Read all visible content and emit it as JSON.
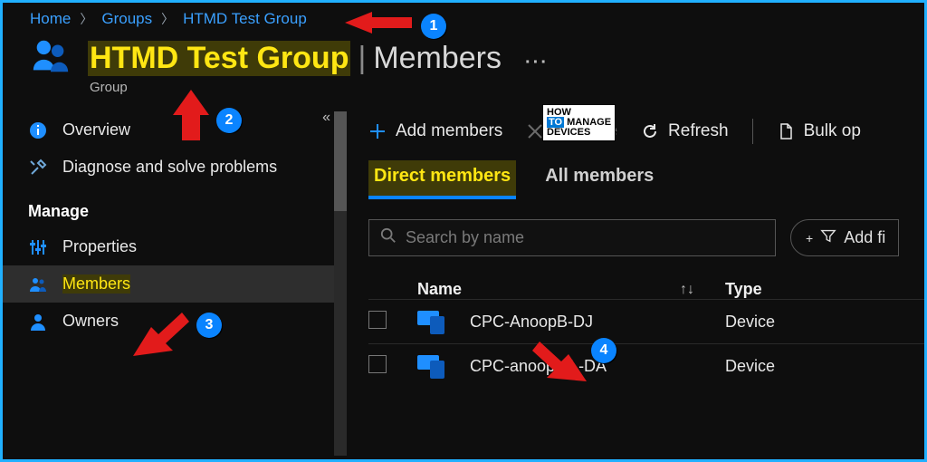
{
  "breadcrumb": {
    "home": "Home",
    "groups": "Groups",
    "group_name": "HTMD Test Group"
  },
  "header": {
    "title_highlight": "HTMD Test Group",
    "title_subpage": "Members",
    "subtitle": "Group",
    "more": "···"
  },
  "sidebar": {
    "items": [
      {
        "icon": "info",
        "label": "Overview"
      },
      {
        "icon": "wrench",
        "label": "Diagnose and solve problems"
      }
    ],
    "manage_label": "Manage",
    "manage_items": [
      {
        "icon": "sliders",
        "label": "Properties"
      },
      {
        "icon": "people",
        "label": "Members"
      },
      {
        "icon": "person",
        "label": "Owners"
      }
    ]
  },
  "toolbar": {
    "add": "Add members",
    "remove": "Remove",
    "refresh": "Refresh",
    "bulk": "Bulk op"
  },
  "tabs": {
    "direct": "Direct members",
    "all": "All members"
  },
  "search": {
    "placeholder": "Search by name"
  },
  "filter": {
    "label": "Add fi"
  },
  "columns": {
    "name": "Name",
    "type": "Type",
    "sort": "↑↓"
  },
  "rows": [
    {
      "name": "CPC-AnoopB-DJ",
      "type": "Device"
    },
    {
      "name": "CPC-anoopb-L-DA",
      "type": "Device"
    }
  ],
  "annotations": {
    "b1": "1",
    "b2": "2",
    "b3": "3",
    "b4": "4"
  },
  "watermark": {
    "l1": "HOW",
    "l2": "TO",
    "l3": "MANAGE",
    "l4": "DEVICES"
  }
}
